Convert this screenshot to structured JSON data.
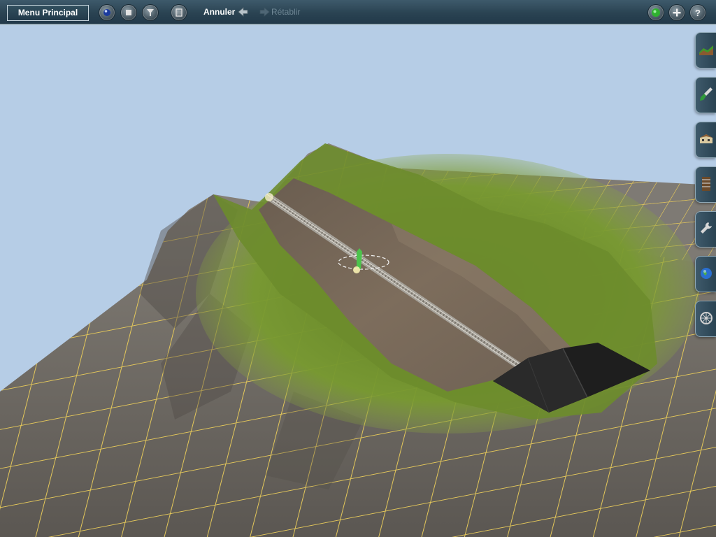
{
  "toolbar": {
    "main_menu_label": "Menu Principal",
    "undo_label": "Annuler",
    "redo_label": "Rétablir",
    "left_buttons": [
      "view-mode-icon",
      "stop-icon",
      "filter-icon",
      "trash-icon"
    ],
    "right_buttons": [
      "status-light-icon",
      "add-icon",
      "help-icon"
    ]
  },
  "side_tabs": [
    "terrain-tool-icon",
    "paint-tool-icon",
    "objects-tool-icon",
    "track-tool-icon",
    "wrench-tool-icon",
    "world-tool-icon",
    "wheel-tool-icon"
  ],
  "colors": {
    "sky": "#b6cde6",
    "grid_lines": "#e6c95a",
    "terrain": "#6f6a63",
    "grass": "#6c8a2e",
    "dirt": "#7a6a58",
    "toolbar": "#2a4352"
  }
}
